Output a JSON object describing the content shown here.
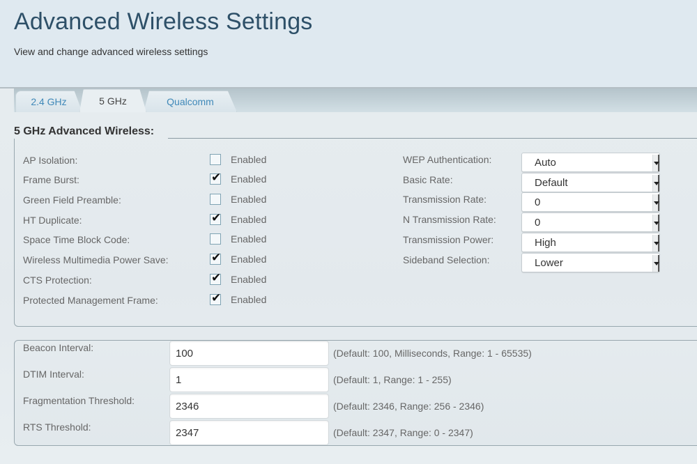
{
  "header": {
    "title": "Advanced Wireless Settings",
    "subtitle": "View and change advanced wireless settings"
  },
  "tabs": [
    {
      "label": "2.4 GHz",
      "active": false
    },
    {
      "label": "5 GHz",
      "active": true
    },
    {
      "label": "Qualcomm",
      "active": false
    }
  ],
  "section": {
    "title": "5 GHz Advanced Wireless:"
  },
  "checkbox_options": [
    {
      "label": "AP Isolation:",
      "checked": false,
      "option_label": "Enabled"
    },
    {
      "label": "Frame Burst:",
      "checked": true,
      "option_label": "Enabled"
    },
    {
      "label": "Green Field Preamble:",
      "checked": false,
      "option_label": "Enabled"
    },
    {
      "label": "HT Duplicate:",
      "checked": true,
      "option_label": "Enabled"
    },
    {
      "label": "Space Time Block Code:",
      "checked": false,
      "option_label": "Enabled"
    },
    {
      "label": "Wireless Multimedia Power Save:",
      "checked": true,
      "option_label": "Enabled"
    },
    {
      "label": "CTS Protection:",
      "checked": true,
      "option_label": "Enabled"
    },
    {
      "label": "Protected Management Frame:",
      "checked": true,
      "option_label": "Enabled"
    }
  ],
  "select_options": [
    {
      "label": "WEP Authentication:",
      "value": "Auto"
    },
    {
      "label": "Basic Rate:",
      "value": "Default"
    },
    {
      "label": "Transmission Rate:",
      "value": "0"
    },
    {
      "label": "N Transmission Rate:",
      "value": "0"
    },
    {
      "label": "Transmission Power:",
      "value": "High"
    },
    {
      "label": "Sideband Selection:",
      "value": "Lower"
    }
  ],
  "text_fields": [
    {
      "label": "Beacon Interval:",
      "value": "100",
      "hint": "(Default: 100, Milliseconds, Range: 1 - 65535)"
    },
    {
      "label": "DTIM Interval:",
      "value": "1",
      "hint": "(Default: 1, Range: 1 - 255)"
    },
    {
      "label": "Fragmentation Threshold:",
      "value": "2346",
      "hint": "(Default: 2346, Range: 256 - 2346)"
    },
    {
      "label": "RTS Threshold:",
      "value": "2347",
      "hint": "(Default: 2347, Range: 0 - 2347)"
    }
  ]
}
